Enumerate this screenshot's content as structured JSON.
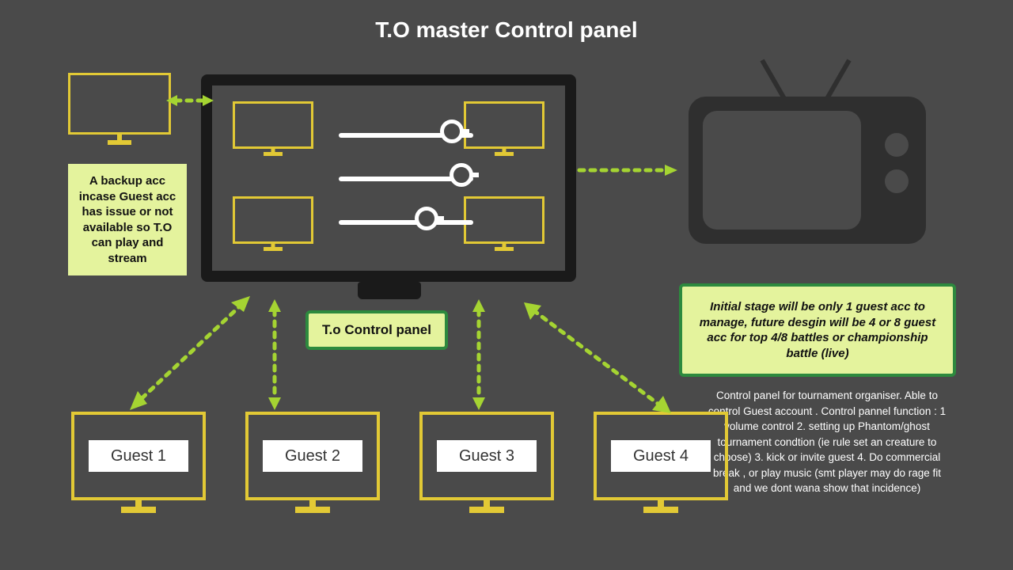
{
  "title": "T.O master Control panel",
  "notes": {
    "backup": "A backup acc incase Guest acc has issue or not available so T.O can play and stream",
    "control_label": "T.o Control panel",
    "initial_stage": "Initial stage will be only 1 guest acc to manage, future desgin will be 4 or 8 guest acc for top 4/8 battles or championship battle (live)"
  },
  "guests": [
    "Guest 1",
    "Guest 2",
    "Guest 3",
    "Guest 4"
  ],
  "explanation": "Control panel for tournament organiser. Able to control Guest account . Control pannel function : 1 volume control 2. setting up Phantom/ghost tournament condtion (ie rule set an creature to choose)  3. kick or invite guest  4. Do commercial break , or play music  (smt player may do rage fit and we dont wana show that incidence)"
}
